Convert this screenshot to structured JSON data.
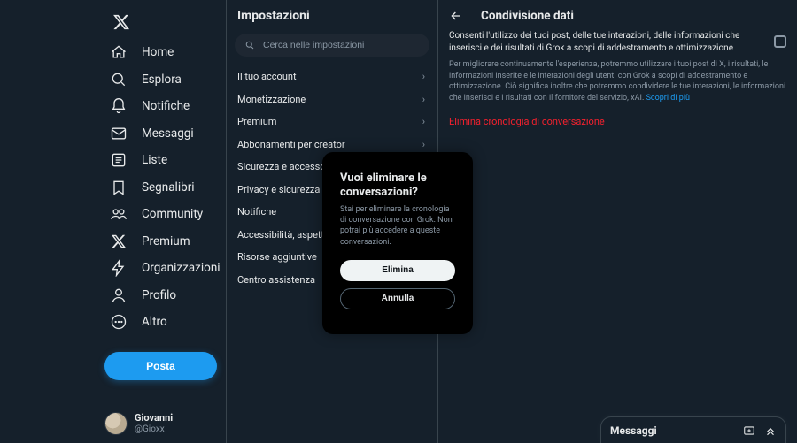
{
  "nav": {
    "items": [
      {
        "label": "Home"
      },
      {
        "label": "Esplora"
      },
      {
        "label": "Notifiche"
      },
      {
        "label": "Messaggi"
      },
      {
        "label": "Liste"
      },
      {
        "label": "Segnalibri"
      },
      {
        "label": "Community"
      },
      {
        "label": "Premium"
      },
      {
        "label": "Organizzazioni verificate"
      },
      {
        "label": "Profilo"
      },
      {
        "label": "Altro"
      }
    ],
    "post_button": "Posta"
  },
  "account": {
    "name": "Giovanni",
    "handle": "@Gioxx"
  },
  "settings": {
    "title": "Impostazioni",
    "search_placeholder": "Cerca nelle impostazioni",
    "items": [
      {
        "label": "Il tuo account"
      },
      {
        "label": "Monetizzazione"
      },
      {
        "label": "Premium"
      },
      {
        "label": "Abbonamenti per creator"
      },
      {
        "label": "Sicurezza e accesso all'account"
      },
      {
        "label": "Privacy e sicurezza"
      },
      {
        "label": "Notifiche"
      },
      {
        "label": "Accessibilità, aspetto e lingue"
      },
      {
        "label": "Risorse aggiuntive"
      },
      {
        "label": "Centro assistenza"
      }
    ]
  },
  "detail": {
    "title": "Condivisione dati",
    "consent_label": "Consenti l'utilizzo dei tuoi post, delle tue interazioni, delle informazioni che inserisci e dei risultati di Grok a scopi di addestramento e ottimizzazione",
    "consent_desc": "Per migliorare continuamente l'esperienza, potremmo utilizzare i tuoi post di X, i risultati, le informazioni inserite e le interazioni degli utenti con Grok a scopi di addestramento e ottimizzazione. Ciò significa inoltre che potremmo condividere le tue interazioni, le informazioni che inserisci e i risultati con il fornitore del servizio, xAI.",
    "consent_link": "Scopri di più",
    "delete_label": "Elimina cronologia di conversazione"
  },
  "modal": {
    "title": "Vuoi eliminare le conversazioni?",
    "desc": "Stai per eliminare la cronologia di conversazione con Grok. Non potrai più accedere a queste conversazioni.",
    "confirm": "Elimina",
    "cancel": "Annulla"
  },
  "messages_drawer": {
    "title": "Messaggi"
  }
}
